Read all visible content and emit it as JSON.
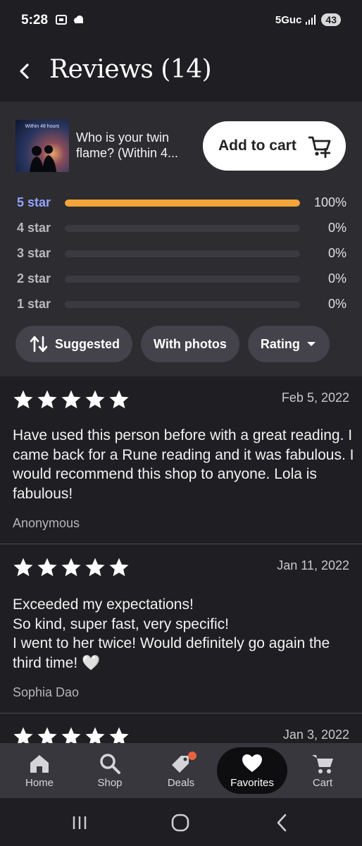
{
  "status": {
    "time": "5:28",
    "network": "5Guc",
    "battery": "43"
  },
  "header": {
    "title": "Reviews (14)"
  },
  "product": {
    "thumb_text": "Within 48 hours",
    "title": "Who is your twin flame? (Within 4...",
    "add_to_cart_label": "Add to cart"
  },
  "rating_breakdown": [
    {
      "label": "5 star",
      "percent_text": "100%",
      "fraction": 1.0
    },
    {
      "label": "4 star",
      "percent_text": "0%",
      "fraction": 0
    },
    {
      "label": "3 star",
      "percent_text": "0%",
      "fraction": 0
    },
    {
      "label": "2 star",
      "percent_text": "0%",
      "fraction": 0
    },
    {
      "label": "1 star",
      "percent_text": "0%",
      "fraction": 0
    }
  ],
  "filters": {
    "suggested": "Suggested",
    "with_photos": "With photos",
    "rating": "Rating"
  },
  "reviews": [
    {
      "stars": 5,
      "date": "Feb 5, 2022",
      "text": "Have used this person before with a great reading. I came back for a Rune reading and it was fabulous. I would recommend this shop to anyone. Lola is fabulous!",
      "author": "Anonymous"
    },
    {
      "stars": 5,
      "date": "Jan 11, 2022",
      "text": "Exceeded my expectations!\nSo kind, super fast, very specific!\nI went to her twice! Would definitely go again the third time! 🤍",
      "author": "Sophia Dao"
    },
    {
      "stars": 5,
      "date": "Jan 3, 2022",
      "text": "",
      "author": ""
    }
  ],
  "bottom_nav": [
    {
      "label": "Home",
      "icon": "home-icon"
    },
    {
      "label": "Shop",
      "icon": "search-icon"
    },
    {
      "label": "Deals",
      "icon": "tag-icon"
    },
    {
      "label": "Favorites",
      "icon": "heart-icon",
      "active": true
    },
    {
      "label": "Cart",
      "icon": "cart-icon"
    }
  ],
  "colors": {
    "accent_bar": "#f3a53a",
    "active_label": "#93a3ff",
    "background": "#1f1e22",
    "panel": "#2d2c31"
  }
}
